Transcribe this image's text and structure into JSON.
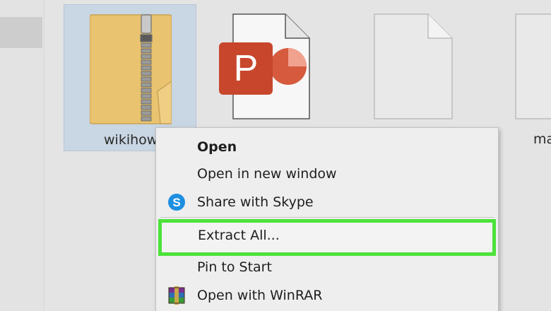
{
  "files": [
    {
      "name": "wikihow",
      "type": "zip",
      "icon": "zip-folder-icon",
      "selected": true
    },
    {
      "name": "",
      "type": "pptx",
      "icon": "powerpoint-file-icon",
      "icon_letter": "P"
    },
    {
      "name": "",
      "type": "file",
      "icon": "blank-file-icon"
    },
    {
      "name": "ma",
      "type": "file",
      "icon": "blank-file-icon"
    }
  ],
  "context_menu": {
    "items": [
      {
        "label": "Open",
        "bold": true,
        "icon": ""
      },
      {
        "label": "Open in new window",
        "icon": ""
      },
      {
        "label": "Share with Skype",
        "icon": "skype-icon",
        "icon_letter": "S"
      },
      {
        "label": "Extract All...",
        "icon": "",
        "highlighted": true
      },
      {
        "label": "Pin to Start",
        "icon": ""
      },
      {
        "label": "Open with WinRAR",
        "icon": "winrar-icon"
      }
    ]
  },
  "colors": {
    "highlight": "#4ce23a",
    "selection": "#c9d6e3",
    "powerpoint": "#c8472c",
    "skype": "#1d8fe1"
  }
}
